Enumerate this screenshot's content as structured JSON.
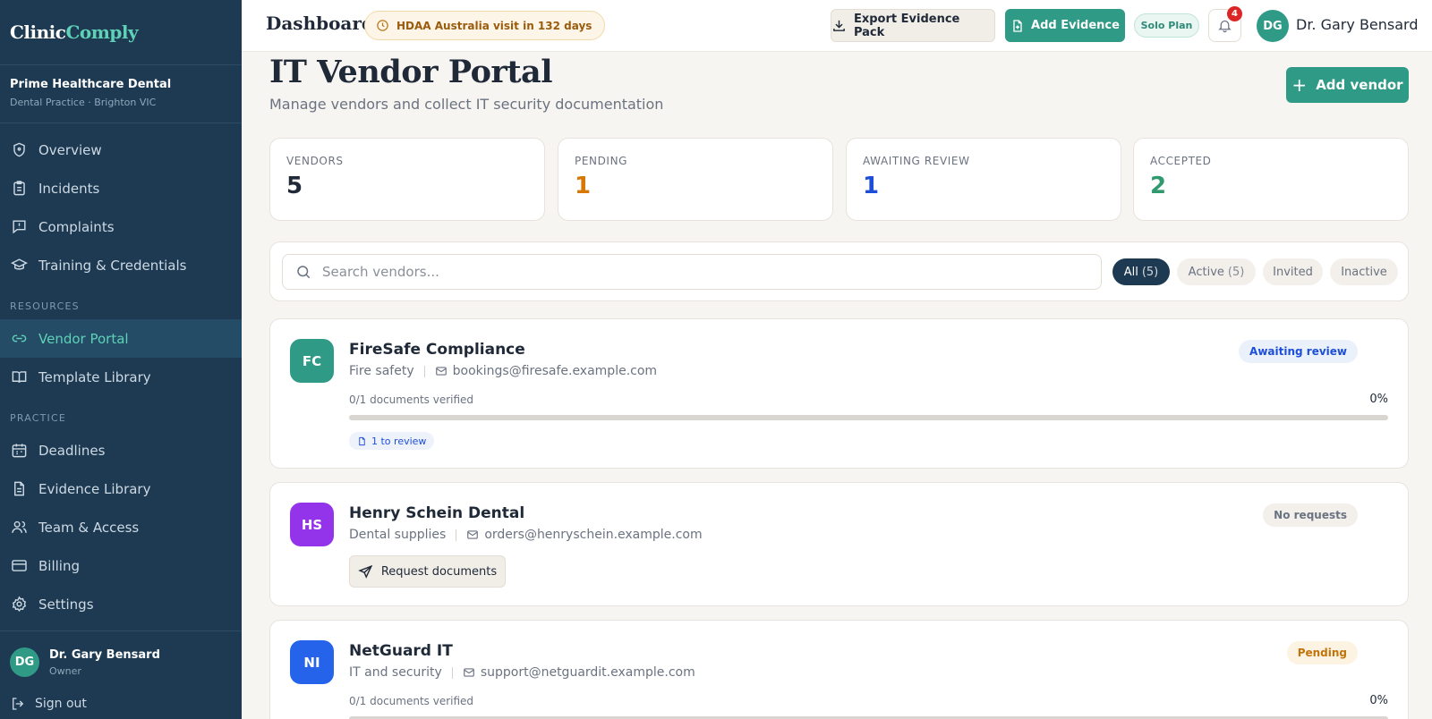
{
  "brand": {
    "part1": "Clinic",
    "part2": "Comply"
  },
  "practice": {
    "name": "Prime Healthcare Dental",
    "subtitle": "Dental Practice · Brighton VIC"
  },
  "sidebar": {
    "main_items": [
      {
        "label": "Overview",
        "icon": "shield-icon"
      },
      {
        "label": "Incidents",
        "icon": "clipboard-icon"
      },
      {
        "label": "Complaints",
        "icon": "message-alert-icon"
      },
      {
        "label": "Training & Credentials",
        "icon": "graduation-cap-icon"
      }
    ],
    "resources_label": "RESOURCES",
    "resources_items": [
      {
        "label": "Vendor Portal",
        "icon": "link-icon",
        "active": true
      },
      {
        "label": "Template Library",
        "icon": "book-icon"
      }
    ],
    "practice_label": "PRACTICE",
    "practice_items": [
      {
        "label": "Deadlines",
        "icon": "calendar-icon"
      },
      {
        "label": "Evidence Library",
        "icon": "document-icon"
      },
      {
        "label": "Team & Access",
        "icon": "users-icon"
      },
      {
        "label": "Billing",
        "icon": "credit-card-icon"
      },
      {
        "label": "Settings",
        "icon": "gear-icon"
      }
    ],
    "user": {
      "initials": "DG",
      "name": "Dr. Gary Bensard",
      "role": "Owner"
    },
    "signout_label": "Sign out"
  },
  "topbar": {
    "title": "Dashboard",
    "visit_badge": "HDAA Australia visit in 132 days",
    "export_label": "Export Evidence Pack",
    "add_evidence_label": "Add Evidence",
    "plan_label": "Solo Plan",
    "notification_count": "4",
    "user_initials": "DG",
    "user_name": "Dr. Gary Bensard"
  },
  "main": {
    "title": "IT Vendor Portal",
    "subtitle": "Manage vendors and collect IT security documentation",
    "add_vendor_label": "Add vendor",
    "stats": [
      {
        "label": "VENDORS",
        "value": "5",
        "color": "#1f2937"
      },
      {
        "label": "PENDING",
        "value": "1",
        "color": "#d97706"
      },
      {
        "label": "AWAITING REVIEW",
        "value": "1",
        "color": "#1d4ed8"
      },
      {
        "label": "ACCEPTED",
        "value": "2",
        "color": "#2f9a6e"
      }
    ],
    "search_placeholder": "Search vendors...",
    "filters": [
      {
        "label": "All",
        "count": "(5)",
        "active": true
      },
      {
        "label": "Active",
        "count": "(5)",
        "active": false
      },
      {
        "label": "Invited",
        "count": "",
        "active": false
      },
      {
        "label": "Inactive",
        "count": "",
        "active": false
      }
    ],
    "vendors": [
      {
        "initials": "FC",
        "avatar_color": "#2f9a86",
        "name": "FireSafe Compliance",
        "category": "Fire safety",
        "email": "bookings@firesafe.example.com",
        "status": "Awaiting review",
        "status_bg": "#eaf1fb",
        "status_color": "#1d4ed8",
        "docs_label": "0/1 documents verified",
        "docs_pct": "0%",
        "progress": 0,
        "review_chip": "1 to review"
      },
      {
        "initials": "HS",
        "avatar_color": "#9333ea",
        "name": "Henry Schein Dental",
        "category": "Dental supplies",
        "email": "orders@henryschein.example.com",
        "status": "No requests",
        "status_bg": "#f3f0eb",
        "status_color": "#6b7280",
        "request_label": "Request documents"
      },
      {
        "initials": "NI",
        "avatar_color": "#2563eb",
        "name": "NetGuard IT",
        "category": "IT and security",
        "email": "support@netguardit.example.com",
        "status": "Pending",
        "status_bg": "#fdf3e3",
        "status_color": "#c2740a",
        "docs_label": "0/1 documents verified",
        "docs_pct": "0%",
        "progress": 0
      }
    ]
  }
}
